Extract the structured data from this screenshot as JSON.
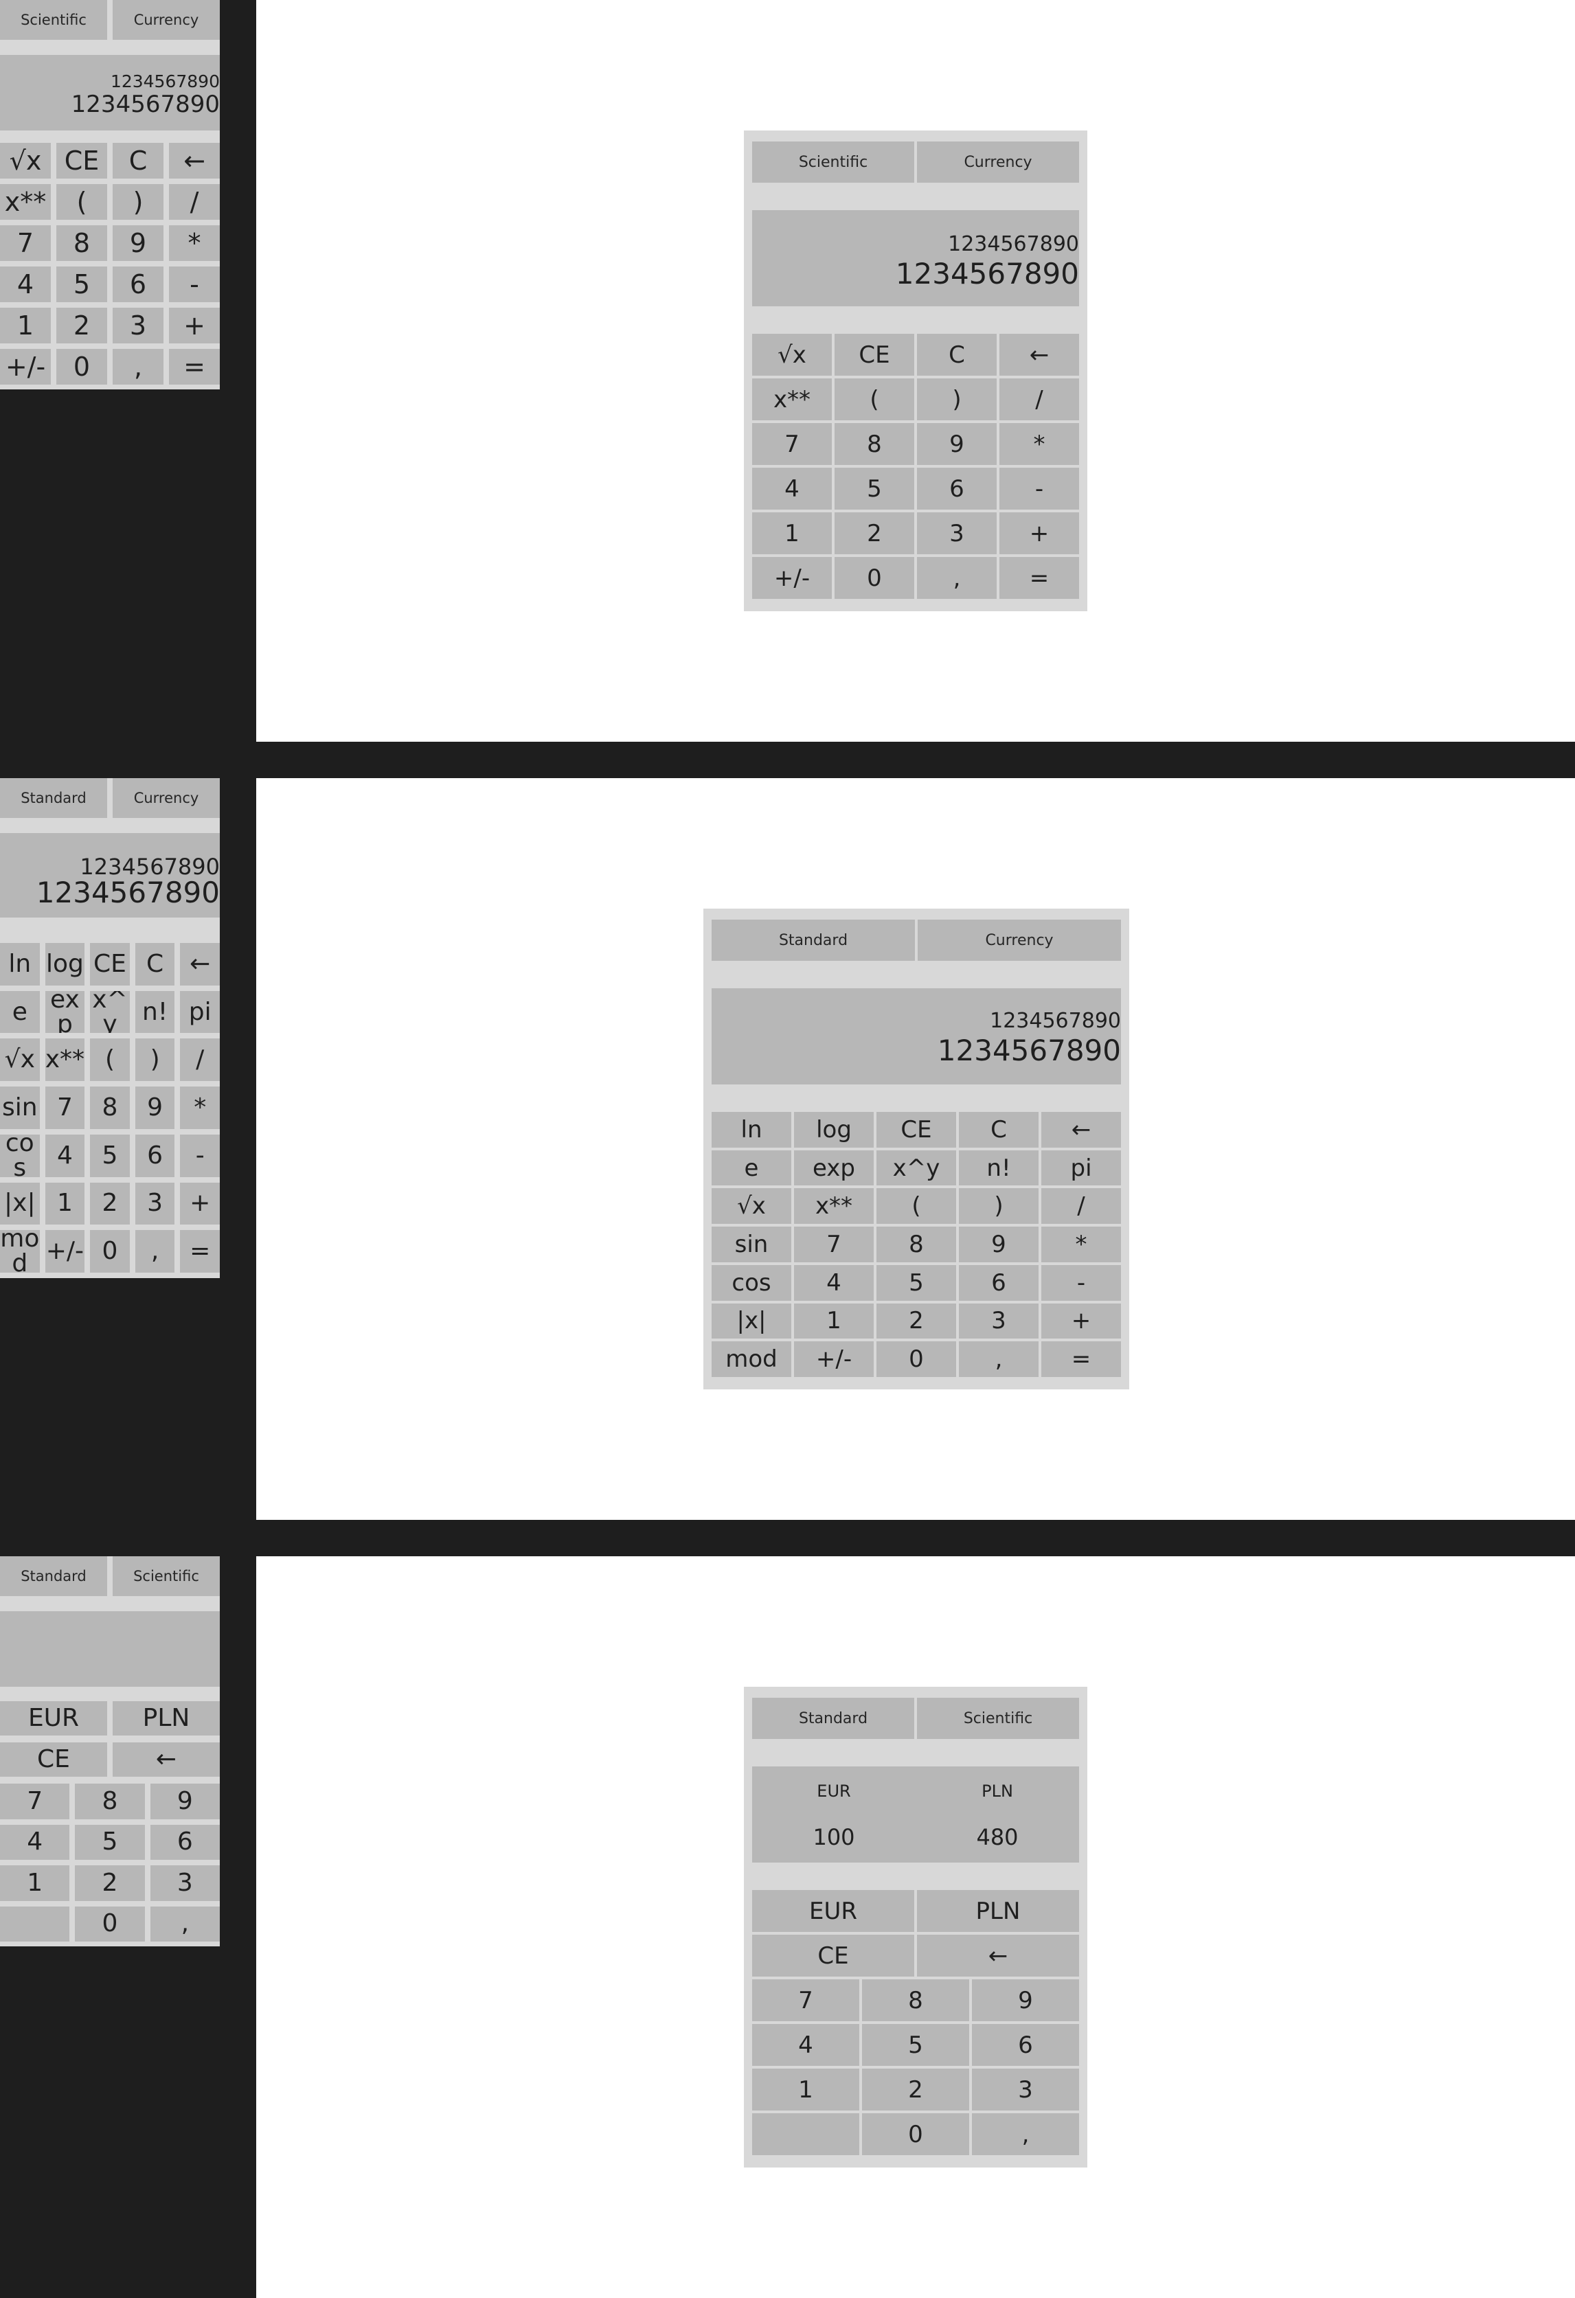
{
  "standard": {
    "tabs": [
      "Scientific",
      "Currency"
    ],
    "display": {
      "expression": "1234567890",
      "value": "1234567890"
    },
    "keys": [
      "√x",
      "CE",
      "C",
      "←",
      "x**",
      "(",
      ")",
      "/",
      "7",
      "8",
      "9",
      "*",
      "4",
      "5",
      "6",
      "-",
      "1",
      "2",
      "3",
      "+",
      "+/-",
      "0",
      ",",
      "="
    ]
  },
  "scientific": {
    "tabs": [
      "Standard",
      "Currency"
    ],
    "display": {
      "expression": "1234567890",
      "value": "1234567890"
    },
    "keys": [
      "ln",
      "log",
      "CE",
      "C",
      "←",
      "e",
      "exp",
      "x^y",
      "n!",
      "pi",
      "√x",
      "x**",
      "(",
      ")",
      "/",
      "sin",
      "7",
      "8",
      "9",
      "*",
      "cos",
      "4",
      "5",
      "6",
      "-",
      "|x|",
      "1",
      "2",
      "3",
      "+",
      "mod",
      "+/-",
      "0",
      ",",
      "="
    ]
  },
  "currency": {
    "tabs": [
      "Standard",
      "Scientific"
    ],
    "display": {
      "from_code": "EUR",
      "from_value": "100",
      "to_code": "PLN",
      "to_value": "480"
    },
    "currency_buttons": [
      "EUR",
      "PLN"
    ],
    "edit_buttons": [
      "CE",
      "←"
    ],
    "digits": [
      "7",
      "8",
      "9",
      "4",
      "5",
      "6",
      "1",
      "2",
      "3",
      "",
      "0",
      ","
    ]
  }
}
